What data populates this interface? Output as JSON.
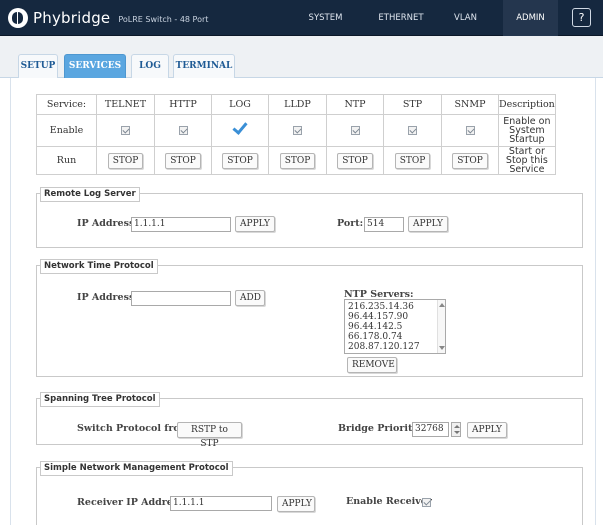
{
  "header": {
    "brand": "Phybridge",
    "product": "PoLRE Switch - 48 Port",
    "nav": [
      {
        "label": "SYSTEM"
      },
      {
        "label": "ETHERNET"
      },
      {
        "label": "VLAN"
      },
      {
        "label": "ADMIN"
      }
    ],
    "help": "?"
  },
  "tabs": [
    {
      "label": "SETUP"
    },
    {
      "label": "SERVICES"
    },
    {
      "label": "LOG"
    },
    {
      "label": "TERMINAL"
    }
  ],
  "services": {
    "row_labels": {
      "service": "Service:",
      "enable": "Enable",
      "run": "Run"
    },
    "description_header": "Description",
    "enable_description": "Enable on System Startup",
    "run_description": "Start or Stop this Service",
    "columns": [
      {
        "name": "TELNET",
        "enabled": true,
        "action": "STOP"
      },
      {
        "name": "HTTP",
        "enabled": true,
        "action": "STOP"
      },
      {
        "name": "LOG",
        "enabled": true,
        "action": "STOP"
      },
      {
        "name": "LLDP",
        "enabled": true,
        "action": "STOP"
      },
      {
        "name": "NTP",
        "enabled": true,
        "action": "STOP"
      },
      {
        "name": "STP",
        "enabled": true,
        "action": "STOP"
      },
      {
        "name": "SNMP",
        "enabled": true,
        "action": "STOP"
      }
    ]
  },
  "remote_log": {
    "title": "Remote Log Server",
    "ip_label": "IP Address:",
    "ip_value": "1.1.1.1",
    "apply": "APPLY",
    "port_label": "Port:",
    "port_value": "514",
    "port_apply": "APPLY"
  },
  "ntp": {
    "title": "Network Time Protocol",
    "ip_label": "IP Address:",
    "ip_value": "",
    "add": "ADD",
    "servers_label": "NTP Servers:",
    "servers": [
      "216.235.14.36",
      "96.44.157.90",
      "96.44.142.5",
      "66.178.0.74",
      "208.87.120.127"
    ],
    "remove": "REMOVE"
  },
  "stp": {
    "title": "Spanning Tree Protocol",
    "switch_label": "Switch Protocol from",
    "switch_button": "RSTP to STP",
    "priority_label": "Bridge Priority:",
    "priority_value": "32768",
    "apply": "APPLY"
  },
  "snmp": {
    "title": "Simple Network Management Protocol",
    "receiver_label": "Receiver IP Address:",
    "receiver_value": "1.1.1.1",
    "apply": "APPLY",
    "enable_label": "Enable Receiver",
    "enable_checked": true
  }
}
